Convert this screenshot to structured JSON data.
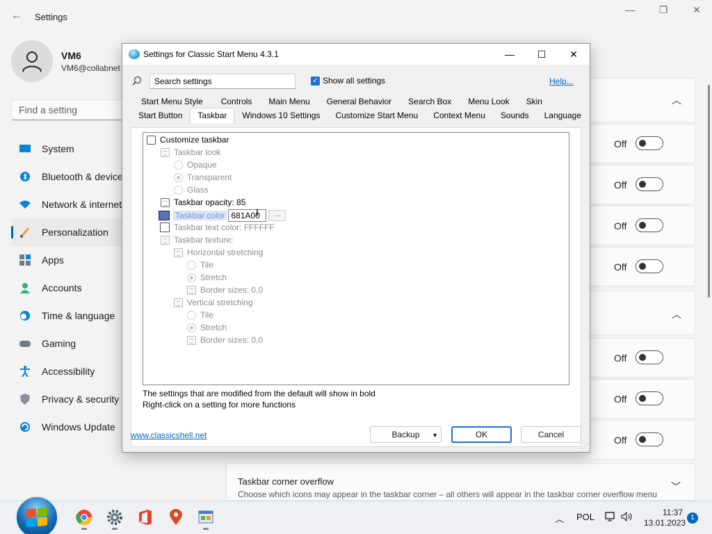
{
  "bg_settings": {
    "title": "Settings",
    "back_glyph": "←",
    "window_controls": [
      "—",
      "❐",
      "✕"
    ],
    "user": {
      "name": "VM6",
      "email": "VM6@collabnet"
    },
    "search_placeholder": "Find a setting",
    "nav": [
      {
        "label": "System",
        "icon": "monitor-icon"
      },
      {
        "label": "Bluetooth & devices",
        "icon": "bluetooth-icon"
      },
      {
        "label": "Network & internet",
        "icon": "wifi-icon"
      },
      {
        "label": "Personalization",
        "icon": "brush-icon",
        "active": true
      },
      {
        "label": "Apps",
        "icon": "apps-icon"
      },
      {
        "label": "Accounts",
        "icon": "person-icon"
      },
      {
        "label": "Time & language",
        "icon": "clock-globe-icon"
      },
      {
        "label": "Gaming",
        "icon": "gamepad-icon"
      },
      {
        "label": "Accessibility",
        "icon": "accessibility-icon"
      },
      {
        "label": "Privacy & security",
        "icon": "shield-icon"
      },
      {
        "label": "Windows Update",
        "icon": "update-icon"
      }
    ],
    "off_label": "Off",
    "overflow": {
      "title": "Taskbar corner overflow",
      "subtitle": "Choose which icons may appear in the taskbar corner – all others will appear in the taskbar corner overflow menu"
    }
  },
  "dialog": {
    "title": "Settings for Classic Start Menu 4.3.1",
    "search_placeholder": "Search settings",
    "show_all_label": "Show all settings",
    "show_all_checked": true,
    "help_label": "Help...",
    "tabs_row1": [
      "Start Menu Style",
      "Controls",
      "Main Menu",
      "General Behavior",
      "Search Box",
      "Menu Look",
      "Skin"
    ],
    "tabs_row2": [
      "Start Button",
      "Taskbar",
      "Windows 10 Settings",
      "Customize Start Menu",
      "Context Menu",
      "Sounds",
      "Language"
    ],
    "selected_tab": "Taskbar",
    "tree": {
      "customize_taskbar": "Customize taskbar",
      "taskbar_look": "Taskbar look",
      "opaque": "Opaque",
      "transparent": "Transparent",
      "glass": "Glass",
      "taskbar_opacity": "Taskbar opacity: 85",
      "taskbar_color": "Taskbar color",
      "taskbar_color_value": "681A00",
      "dots": "...",
      "taskbar_text_color": "Taskbar text color: FFFFFF",
      "taskbar_texture": "Taskbar texture:",
      "horizontal_stretching": "Horizontal stretching",
      "h_tile": "Tile",
      "h_stretch": "Stretch",
      "h_border": "Border sizes: 0,0",
      "vertical_stretching": "Vertical stretching",
      "v_tile": "Tile",
      "v_stretch": "Stretch",
      "v_border": "Border sizes: 0,0"
    },
    "hint_line1": "The settings that are modified from the default will show in bold",
    "hint_line2": "Right-click on a setting for more functions",
    "website": "www.classicshell.net",
    "buttons": {
      "backup": "Backup",
      "ok": "OK",
      "cancel": "Cancel"
    }
  },
  "taskbar": {
    "tray_language": "POL",
    "time": "11:37",
    "date": "13.01.2023",
    "notification_count": "1"
  },
  "colors": {
    "accent": "#005fb8",
    "taskbar_color_swatch": "#5a73b8",
    "link": "#0066cc"
  }
}
